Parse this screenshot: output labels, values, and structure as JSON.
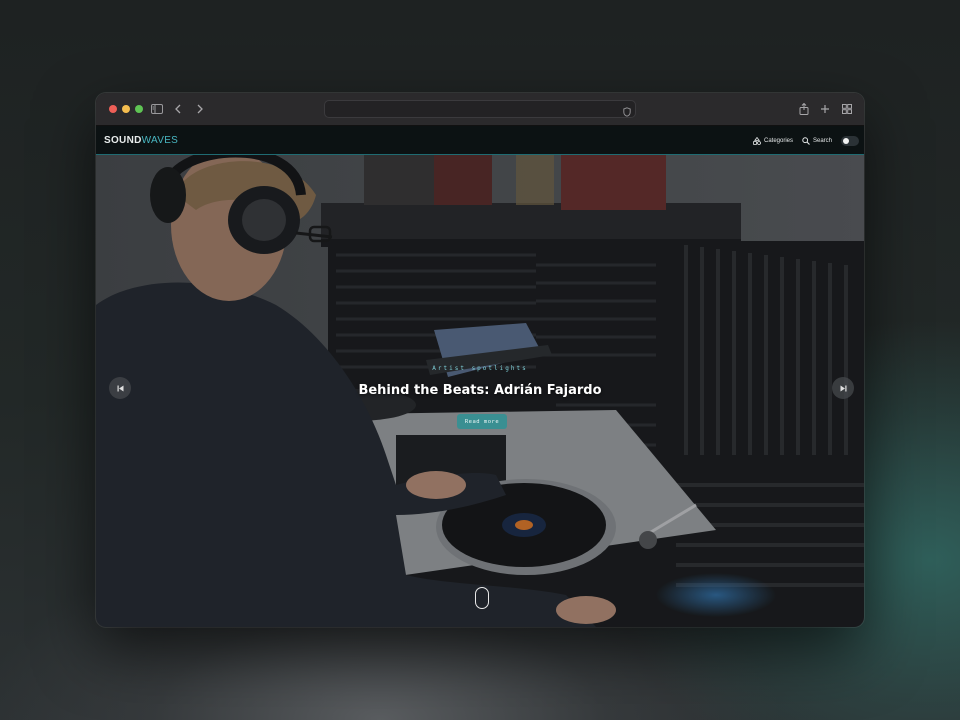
{
  "site": {
    "logo_part1": "SOUND",
    "logo_part2": "WAVES",
    "nav": [
      {
        "label": "Categories",
        "icon": "categories-icon"
      },
      {
        "label": "Search",
        "icon": "search-icon"
      }
    ],
    "theme_toggle_icon": "moon-icon"
  },
  "hero": {
    "eyebrow": "Artist spotlights",
    "title": "Behind the Beats: Adrián Fajardo",
    "cta_label": "Read more",
    "prev_icon": "skip-previous-icon",
    "next_icon": "skip-next-icon",
    "scroll_icon": "scroll-mouse-icon"
  },
  "colors": {
    "accent": "#49b6c1",
    "button": "#3a8f92",
    "nav_bg": "#0c1213"
  }
}
